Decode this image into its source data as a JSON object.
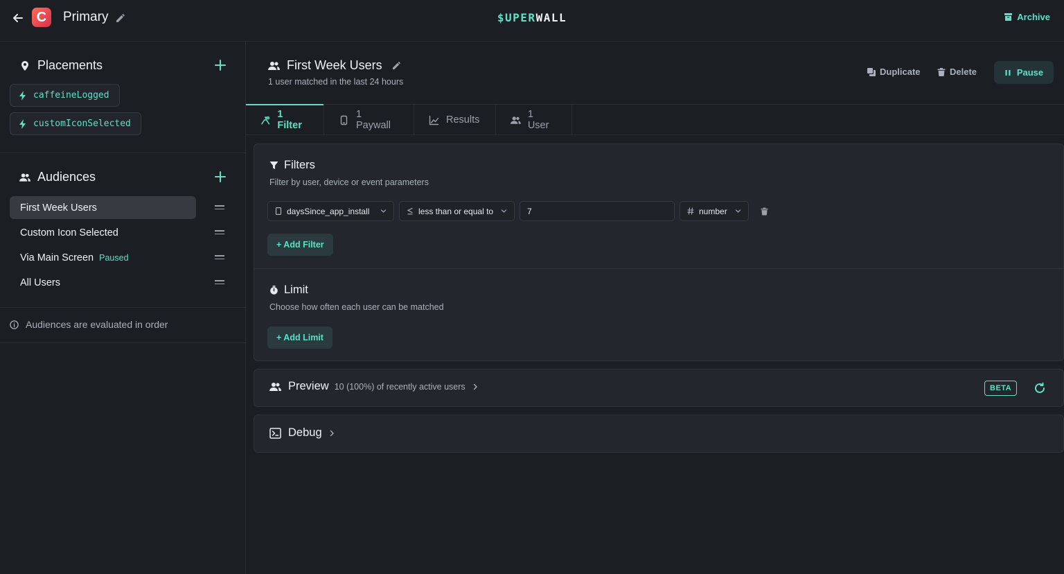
{
  "app": {
    "title": "Primary",
    "icon_letter": "C"
  },
  "brand": {
    "part1": "$UPER",
    "part2": "WALL"
  },
  "header": {
    "archive_label": "Archive"
  },
  "placements": {
    "title": "Placements",
    "items": [
      "caffeineLogged",
      "customIconSelected"
    ]
  },
  "audiences": {
    "title": "Audiences",
    "items": [
      {
        "label": "First Week Users",
        "badge": ""
      },
      {
        "label": "Custom Icon Selected",
        "badge": ""
      },
      {
        "label": "Via Main Screen",
        "badge": "Paused"
      },
      {
        "label": "All Users",
        "badge": ""
      }
    ],
    "note": "Audiences are evaluated in order"
  },
  "audience": {
    "title": "First Week Users",
    "subtitle": "1 user matched in the last 24 hours",
    "duplicate_label": "Duplicate",
    "delete_label": "Delete",
    "pause_label": "Pause"
  },
  "tabs": [
    {
      "label": "1 Filter",
      "icon": "filter-branch-icon"
    },
    {
      "label": "1 Paywall",
      "icon": "phone-icon"
    },
    {
      "label": "Results",
      "icon": "chart-icon"
    },
    {
      "label": "1 User",
      "icon": "users-icon"
    }
  ],
  "filters": {
    "title": "Filters",
    "subtitle": "Filter by user, device or event parameters",
    "rule": {
      "field": "daysSince_app_install",
      "operator": "less than or equal to",
      "value": "7",
      "type": "number"
    },
    "add_label": "+ Add Filter"
  },
  "limit": {
    "title": "Limit",
    "subtitle": "Choose how often each user can be matched",
    "add_label": "+ Add Limit"
  },
  "preview": {
    "title": "Preview",
    "meta": "10 (100%) of recently active users",
    "badge": "BETA"
  },
  "debug": {
    "title": "Debug"
  },
  "colors": {
    "accent": "#5ee0c7",
    "background": "#1b1e23",
    "panel": "#23272d"
  }
}
